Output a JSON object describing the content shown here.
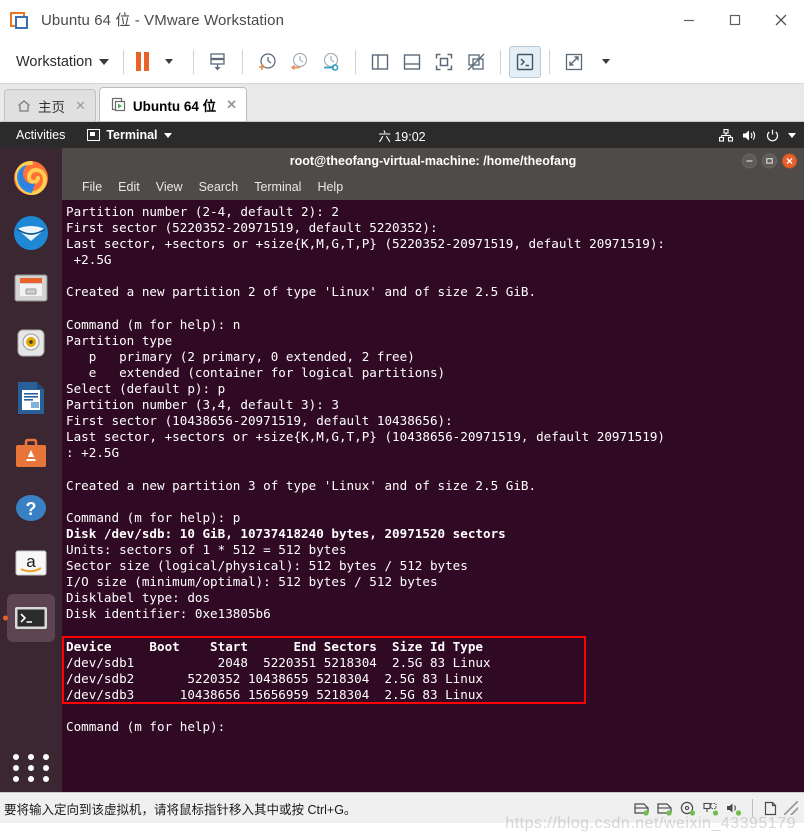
{
  "window": {
    "title": "Ubuntu 64 位 - VMware Workstation",
    "minimize_label": "—",
    "maximize_label": "▭",
    "close_label": "✕"
  },
  "toolbar": {
    "menu_label": "Workstation",
    "buttons": [
      {
        "name": "pause-button",
        "label": "Pause"
      },
      {
        "name": "pause-dropdown",
        "label": "Pause options"
      },
      {
        "name": "send-ctrl-alt-del-button",
        "label": "Send Ctrl+Alt+Del"
      },
      {
        "name": "take-snapshot-button",
        "label": "Take snapshot"
      },
      {
        "name": "revert-snapshot-button",
        "label": "Revert to snapshot"
      },
      {
        "name": "manage-snapshots-button",
        "label": "Manage snapshots"
      },
      {
        "name": "show-library-button",
        "label": "Show or hide the library"
      },
      {
        "name": "show-thumbnail-bar-button",
        "label": "Show or hide thumbnail bar"
      },
      {
        "name": "fullscreen-button",
        "label": "Enter full screen mode"
      },
      {
        "name": "unity-mode-button",
        "label": "Enter Unity mode"
      },
      {
        "name": "console-view-button",
        "label": "Console view"
      },
      {
        "name": "stretch-guest-button",
        "label": "Stretch guest"
      },
      {
        "name": "stretch-dropdown",
        "label": "Stretch options"
      }
    ]
  },
  "tabs": [
    {
      "label": "主页",
      "icon": "home-icon",
      "active": false,
      "close_label": "✕"
    },
    {
      "label": "Ubuntu 64 位",
      "icon": "vm-icon",
      "active": true,
      "close_label": "✕"
    }
  ],
  "guest": {
    "topbar": {
      "activities": "Activities",
      "app_menu": "Terminal",
      "clock": "六 19:02",
      "tray": [
        "network-icon",
        "volume-icon",
        "power-icon",
        "chevron-down-icon"
      ]
    },
    "dock": [
      {
        "name": "firefox",
        "label": "Firefox Web Browser"
      },
      {
        "name": "thunderbird",
        "label": "Thunderbird Mail"
      },
      {
        "name": "files",
        "label": "Files"
      },
      {
        "name": "rhythmbox",
        "label": "Rhythmbox"
      },
      {
        "name": "libreoffice-writer",
        "label": "LibreOffice Writer"
      },
      {
        "name": "ubuntu-software",
        "label": "Ubuntu Software"
      },
      {
        "name": "help",
        "label": "Help"
      },
      {
        "name": "amazon",
        "label": "Amazon"
      },
      {
        "name": "terminal",
        "label": "Terminal",
        "running": true
      }
    ],
    "show_apps_label": "Show Applications",
    "terminal": {
      "title": "root@theofang-virtual-machine: /home/theofang",
      "menu": [
        "File",
        "Edit",
        "View",
        "Search",
        "Terminal",
        "Help"
      ],
      "window_buttons": {
        "minimize": "—",
        "maximize": "▢",
        "close": "✕"
      },
      "lines": [
        "Partition number (2-4, default 2): 2",
        "First sector (5220352-20971519, default 5220352):",
        "Last sector, +sectors or +size{K,M,G,T,P} (5220352-20971519, default 20971519):",
        " +2.5G",
        "",
        "Created a new partition 2 of type 'Linux' and of size 2.5 GiB.",
        "",
        "Command (m for help): n",
        "Partition type",
        "   p   primary (2 primary, 0 extended, 2 free)",
        "   e   extended (container for logical partitions)",
        "Select (default p): p",
        "Partition number (3,4, default 3): 3",
        "First sector (10438656-20971519, default 10438656):",
        "Last sector, +sectors or +size{K,M,G,T,P} (10438656-20971519, default 20971519)",
        ": +2.5G",
        "",
        "Created a new partition 3 of type 'Linux' and of size 2.5 GiB.",
        "",
        "Command (m for help): p",
        "Disk /dev/sdb: 10 GiB, 10737418240 bytes, 20971520 sectors",
        "Units: sectors of 1 * 512 = 512 bytes",
        "Sector size (logical/physical): 512 bytes / 512 bytes",
        "I/O size (minimum/optimal): 512 bytes / 512 bytes",
        "Disklabel type: dos",
        "Disk identifier: 0xe13805b6",
        "",
        "Device     Boot    Start      End Sectors  Size Id Type",
        "/dev/sdb1           2048  5220351 5218304  2.5G 83 Linux",
        "/dev/sdb2       5220352 10438655 5218304  2.5G 83 Linux",
        "/dev/sdb3      10438656 15656959 5218304  2.5G 83 Linux",
        "",
        "Command (m for help):"
      ],
      "partition_table": {
        "headers": [
          "Device",
          "Boot",
          "Start",
          "End",
          "Sectors",
          "Size",
          "Id",
          "Type"
        ],
        "rows": [
          [
            "/dev/sdb1",
            "",
            "2048",
            "5220351",
            "5218304",
            "2.5G",
            "83",
            "Linux"
          ],
          [
            "/dev/sdb2",
            "",
            "5220352",
            "10438655",
            "5218304",
            "2.5G",
            "83",
            "Linux"
          ],
          [
            "/dev/sdb3",
            "",
            "10438656",
            "15656959",
            "5218304",
            "2.5G",
            "83",
            "Linux"
          ]
        ]
      },
      "disk_info": {
        "disk": "/dev/sdb",
        "size": "10 GiB",
        "bytes": "10737418240 bytes",
        "sectors": "20971520 sectors",
        "units": "sectors of 1 * 512 = 512 bytes",
        "sector_size": "512 bytes / 512 bytes",
        "io_size": "512 bytes / 512 bytes",
        "disklabel_type": "dos",
        "disk_identifier": "0xe13805b6"
      },
      "highlight_color": "#ff0000"
    }
  },
  "status": {
    "message": "要将输入定向到该虚拟机，请将鼠标指针移入其中或按 Ctrl+G。",
    "tray": [
      "hard-disk-icon",
      "hard-disk-icon",
      "cd-dvd-icon",
      "network-adapter-icon",
      "sound-card-icon",
      "printer-icon"
    ]
  },
  "watermark": "https://blog.csdn.net/weixin_43395179"
}
